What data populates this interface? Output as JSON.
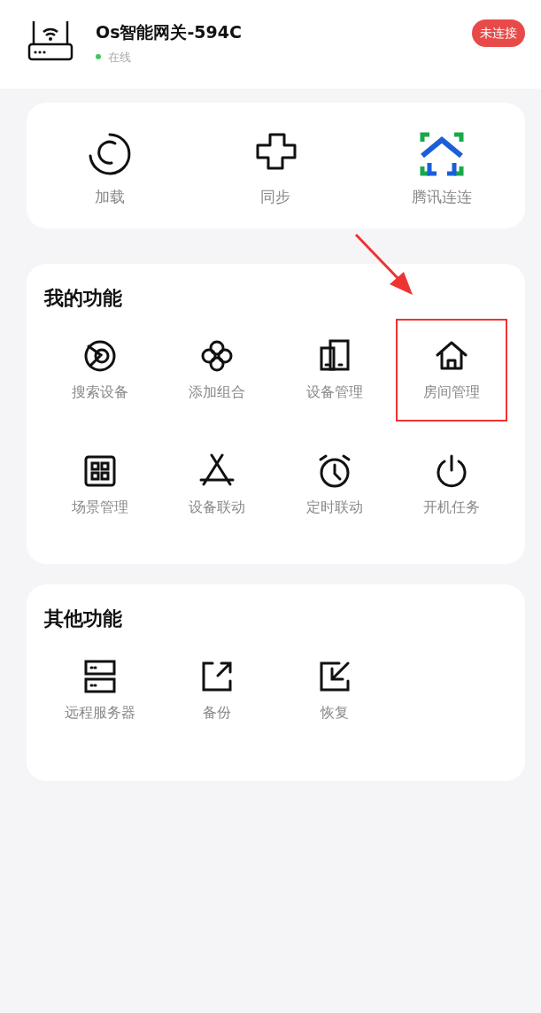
{
  "header": {
    "title": "Os智能网关-594C",
    "status": "在线",
    "online": true,
    "badge": "未连接"
  },
  "quick_actions": [
    {
      "label": "加载"
    },
    {
      "label": "同步"
    },
    {
      "label": "腾讯连连"
    }
  ],
  "my_functions": {
    "title": "我的功能",
    "items": [
      {
        "label": "搜索设备",
        "highlighted": false
      },
      {
        "label": "添加组合",
        "highlighted": false
      },
      {
        "label": "设备管理",
        "highlighted": false
      },
      {
        "label": "房间管理",
        "highlighted": true
      },
      {
        "label": "场景管理",
        "highlighted": false
      },
      {
        "label": "设备联动",
        "highlighted": false
      },
      {
        "label": "定时联动",
        "highlighted": false
      },
      {
        "label": "开机任务",
        "highlighted": false
      }
    ]
  },
  "other_functions": {
    "title": "其他功能",
    "items": [
      {
        "label": "远程服务器"
      },
      {
        "label": "备份"
      },
      {
        "label": "恢复"
      }
    ]
  }
}
